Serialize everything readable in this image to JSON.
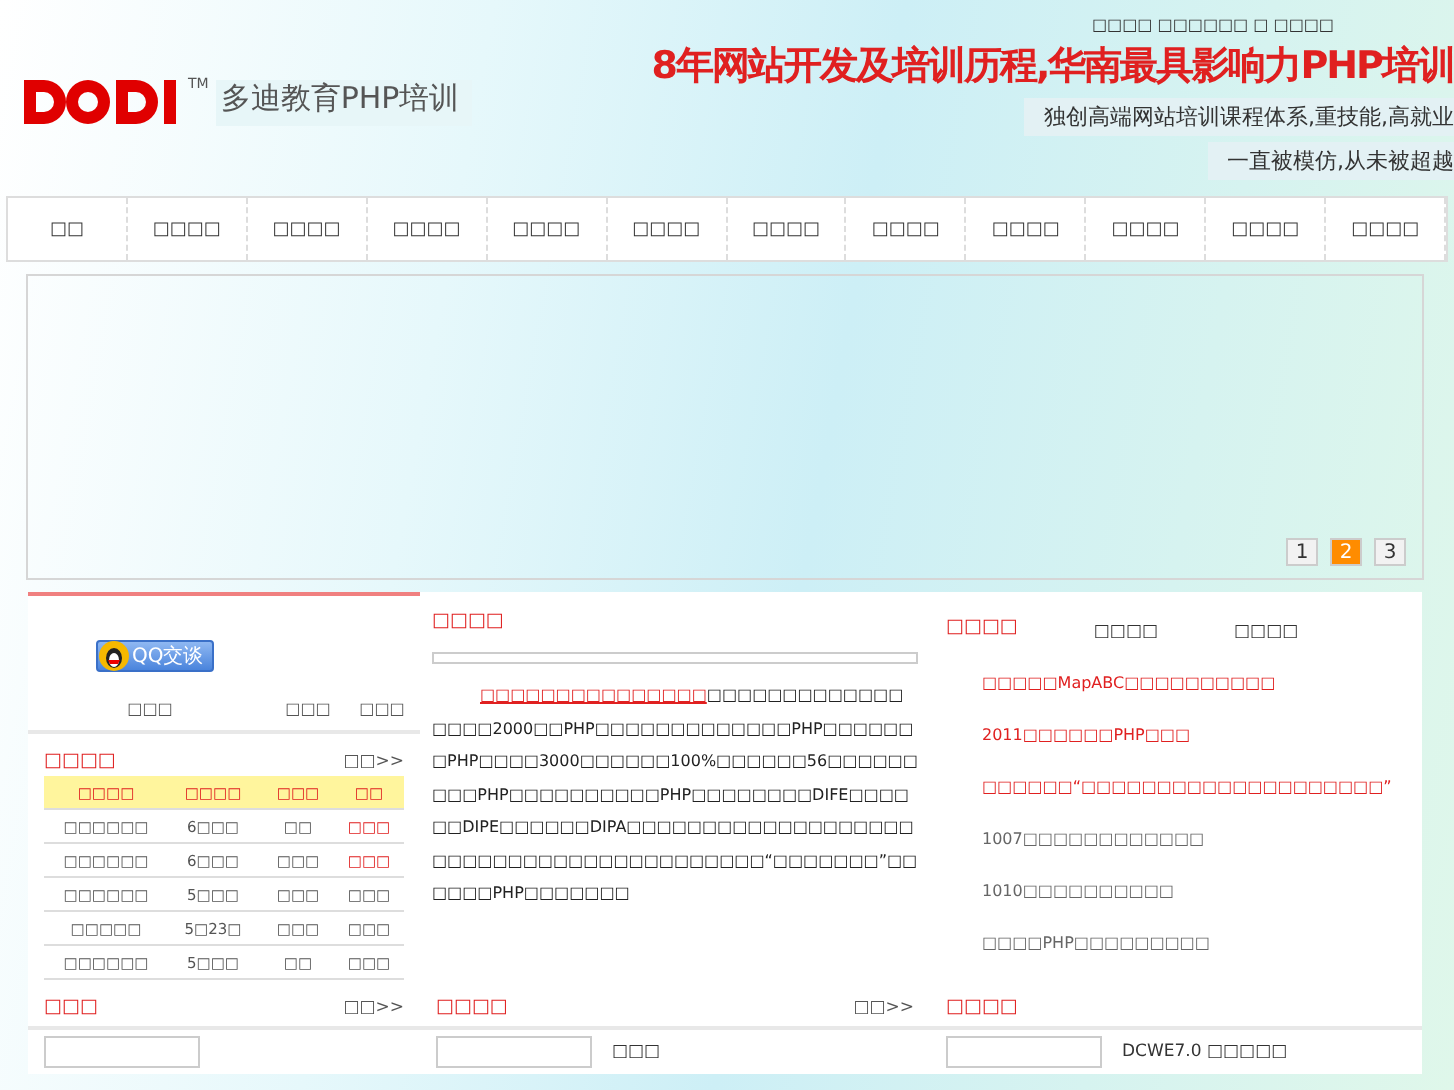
{
  "header": {
    "top_links": "□□□□ □□□□□□ □ □□□□",
    "logo_text": "多迪教育PHP培训",
    "logo_mark": "TM",
    "slogan": "8年网站开发及培训历程,华南最具影响力PHP培训",
    "tagline": "独创高端网站培训课程体系,重技能,高就业",
    "tagline_2": "一直被模仿,从未被超越"
  },
  "nav": [
    "□□",
    "□□□□",
    "□□□□",
    "□□□□",
    "□□□□",
    "□□□□",
    "□□□□",
    "□□□□",
    "□□□□",
    "□□□□",
    "□□□□",
    "□□□□"
  ],
  "banner": {
    "pager": [
      {
        "label": "1",
        "selected": false
      },
      {
        "label": "2",
        "selected": true
      },
      {
        "label": "3",
        "selected": false
      }
    ]
  },
  "left": {
    "qq_button": "QQ交谈",
    "stats": [
      "□□□",
      "□□□",
      "□□□"
    ],
    "schedule": {
      "title": "□□□□",
      "more": "□□>>",
      "columns": [
        "□□□□",
        "□□□□",
        "□□□",
        "□□"
      ],
      "rows": [
        {
          "cells": [
            "□□□□□□",
            "6□□□",
            "□□",
            "□□□"
          ],
          "urgent": true
        },
        {
          "cells": [
            "□□□□□□",
            "6□□□",
            "□□□",
            "□□□"
          ],
          "urgent": true
        },
        {
          "cells": [
            "□□□□□□",
            "5□□□",
            "□□□",
            "□□□"
          ],
          "urgent": false
        },
        {
          "cells": [
            "□□□□□",
            "5□23□",
            "□□□",
            "□□□"
          ],
          "urgent": false
        },
        {
          "cells": [
            "□□□□□□",
            "5□□□",
            "□□",
            "□□□"
          ],
          "urgent": false
        }
      ]
    },
    "bottom": {
      "title": "□□□",
      "more": "□□>>"
    }
  },
  "middle": {
    "title": "□□□□",
    "lead": "□□□□□□□□□□□□□□□",
    "body": "□□□□□□□□□□□□□□□□□2000□□PHP□□□□□□□□□□□□□PHP□□□□□□□PHP□□□□3000□□□□□□100%□□□□□□56□□□□□□□□□PHP□□□□□□□□□□PHP□□□□□□□□DIFE□□□□□□DIPE□□□□□□DIPA□□□□□□□□□□□□□□□□□□□□□□□□□□□□□□□□□□□□□□□□□“□□□□□□□”□□□□□□PHP□□□□□□□",
    "bottom": {
      "title": "□□□□",
      "more": "□□>>",
      "label": "□□□"
    }
  },
  "right": {
    "title": "□□□□",
    "tabs": [
      "□□□□",
      "□□□□"
    ],
    "news": [
      {
        "text": "□□□□□MapABC□□□□□□□□□□",
        "hot": true
      },
      {
        "text": "2011□□□□□□PHP□□□",
        "hot": true
      },
      {
        "text": "□□□□□□“□□□□□□□□□□□□□□□□□□□□”",
        "hot": true
      },
      {
        "text": "1007□□□□□□□□□□□□",
        "hot": false
      },
      {
        "text": "1010□□□□□□□□□□",
        "hot": false
      },
      {
        "text": "□□□□PHP□□□□□□□□□",
        "hot": false
      }
    ],
    "bottom": {
      "title": "□□□□",
      "label": "DCWE7.0 □□□□□"
    }
  }
}
